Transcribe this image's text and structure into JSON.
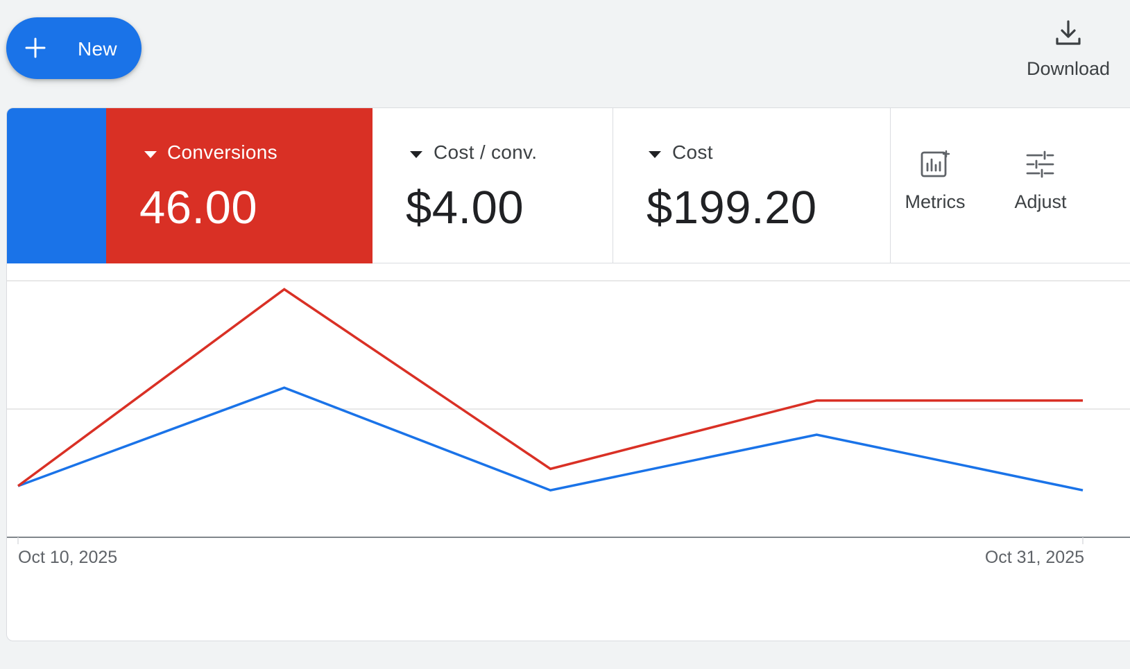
{
  "toolbar": {
    "new_label": "New",
    "download_label": "Download"
  },
  "scorecards": [
    {
      "name": "Conversions",
      "value": "46.00",
      "selected": true,
      "color": "#d93025"
    },
    {
      "name": "Cost / conv.",
      "value": "$4.00",
      "selected": false
    },
    {
      "name": "Cost",
      "value": "$199.20",
      "selected": false
    }
  ],
  "tools": {
    "metrics_label": "Metrics",
    "adjust_label": "Adjust"
  },
  "colors": {
    "primary_blue": "#1a73e8",
    "selected_red": "#d93025"
  },
  "chart_data": {
    "type": "line",
    "grid": true,
    "ylim": [
      0,
      30
    ],
    "x": [
      "Oct 10, 2025",
      "",
      "",
      "",
      "Oct 31, 2025"
    ],
    "xlabel_start": "Oct 10, 2025",
    "xlabel_end": "Oct 31, 2025",
    "series": [
      {
        "color": "#d93025",
        "values": [
          6.0,
          29.0,
          8.0,
          16.0,
          16.0
        ]
      },
      {
        "color": "#1a73e8",
        "values": [
          6.0,
          17.5,
          5.5,
          12.0,
          5.5
        ]
      }
    ]
  }
}
